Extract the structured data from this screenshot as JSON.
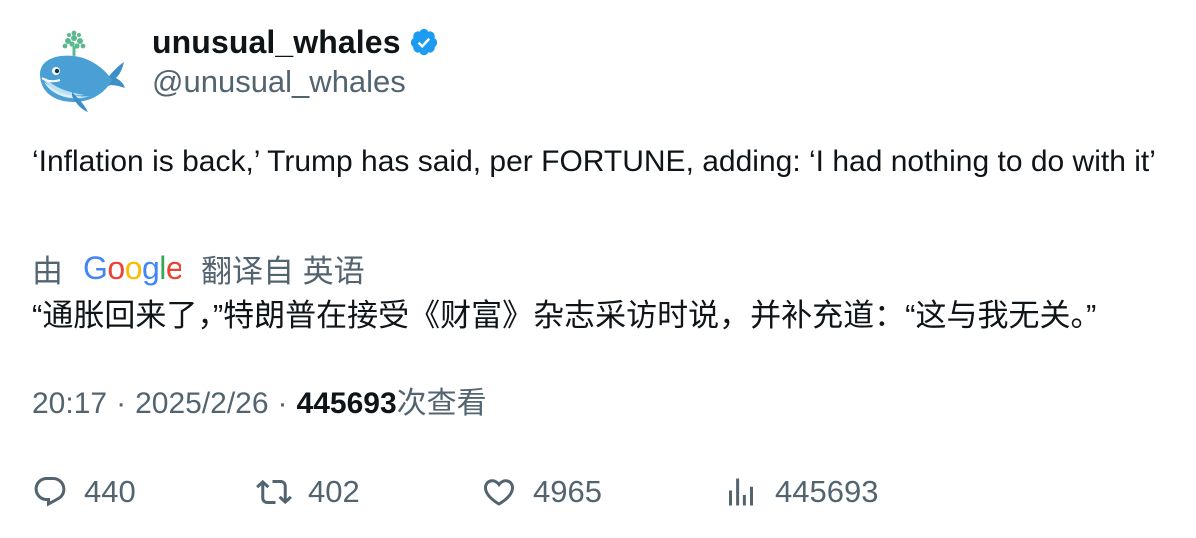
{
  "author": {
    "display_name": "unusual_whales",
    "handle": "@unusual_whales",
    "verified_color": "#1d9bf0"
  },
  "tweet": {
    "text": "‘Inflation is back,’ Trump has said, per FORTUNE, adding: ‘I had nothing to do with it’"
  },
  "translation": {
    "prefix": "由",
    "provider": "Google",
    "suffix": "翻译自 英语",
    "text": "“通胀回来了，”特朗普在接受《财富》杂志采访时说，并补充道：“这与我无关。”"
  },
  "meta": {
    "time": "20:17",
    "separator": "·",
    "date": "2025/2/26",
    "views_count": "445693",
    "views_label": "次查看"
  },
  "actions": {
    "replies": "440",
    "retweets": "402",
    "likes": "4965",
    "views": "445693"
  },
  "icons": {
    "reply": "reply-bubble-icon",
    "retweet": "retweet-icon",
    "like": "heart-icon",
    "views": "bar-chart-icon",
    "verified": "verified-badge-icon",
    "avatar": "whale-avatar"
  },
  "colors": {
    "text": "#0f1419",
    "secondary": "#536471",
    "accent": "#1d9bf0"
  }
}
